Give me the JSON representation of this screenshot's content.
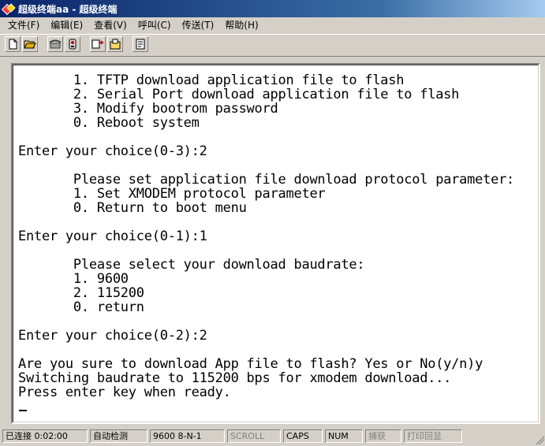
{
  "window": {
    "title": "超级终端aa - 超级终端"
  },
  "menu": [
    "文件(F)",
    "编辑(E)",
    "查看(V)",
    "呼叫(C)",
    "传送(T)",
    "帮助(H)"
  ],
  "toolbar": {
    "buttons": [
      "new-icon",
      "open-icon",
      "call-icon",
      "disconnect-icon",
      "send-icon",
      "receive-icon",
      "properties-icon"
    ]
  },
  "terminal": {
    "lines": [
      "       1. TFTP download application file to flash",
      "       2. Serial Port download application file to flash",
      "       3. Modify bootrom password",
      "       0. Reboot system",
      "",
      "Enter your choice(0-3):2",
      "",
      "       Please set application file download protocol parameter:",
      "       1. Set XMODEM protocol parameter",
      "       0. Return to boot menu",
      "",
      "Enter your choice(0-1):1",
      "",
      "       Please select your download baudrate:",
      "       1. 9600",
      "       2. 115200",
      "       0. return",
      "",
      "Enter your choice(0-2):2",
      "",
      "Are you sure to download App file to flash? Yes or No(y/n)y",
      "Switching baudrate to 115200 bps for xmodem download...",
      "Press enter key when ready."
    ]
  },
  "status": {
    "connected": "已连接 0:02:00",
    "detect": "自动检测",
    "settings": "9600 8-N-1",
    "scroll": "SCROLL",
    "caps": "CAPS",
    "num": "NUM",
    "capture": "捕获",
    "print": "打印回显"
  }
}
